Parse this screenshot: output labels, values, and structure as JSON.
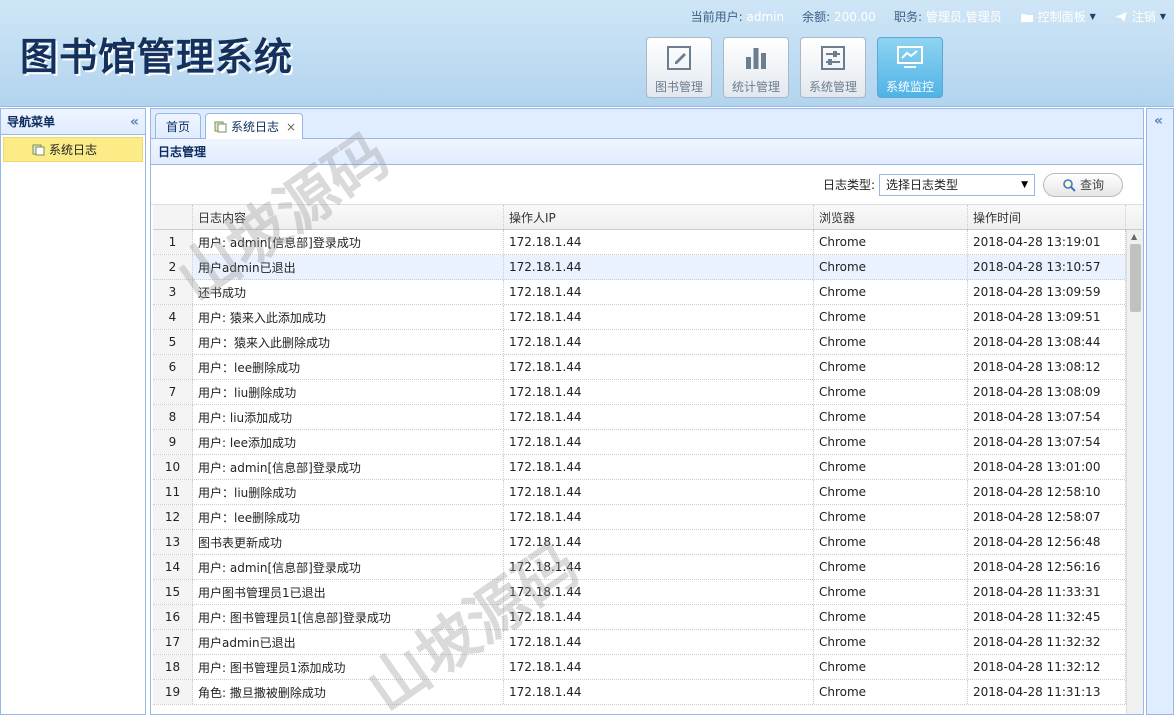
{
  "app": {
    "title": "图书馆管理系统"
  },
  "userbar": {
    "current_user_label": "当前用户:",
    "current_user": "admin",
    "balance_label": "余额:",
    "balance": "200.00",
    "role_label": "职务:",
    "role": "管理员,管理员",
    "control_panel": "控制面板",
    "logout": "注销"
  },
  "modules": [
    {
      "label": "图书管理",
      "icon": "edit-icon"
    },
    {
      "label": "统计管理",
      "icon": "bar-chart-icon"
    },
    {
      "label": "系统管理",
      "icon": "settings-sliders-icon"
    },
    {
      "label": "系统监控",
      "icon": "monitor-icon"
    }
  ],
  "nav": {
    "title": "导航菜单",
    "items": [
      {
        "label": "系统日志"
      }
    ]
  },
  "tabs": [
    {
      "label": "首页"
    },
    {
      "label": "系统日志",
      "close": "×"
    }
  ],
  "panel": {
    "title": "日志管理",
    "filter_label": "日志类型:",
    "filter_value": "选择日志类型",
    "query_button": "查询"
  },
  "grid": {
    "columns": [
      "日志内容",
      "操作人IP",
      "浏览器",
      "操作时间"
    ],
    "rows": [
      {
        "n": "1",
        "content": "用户: admin[信息部]登录成功",
        "ip": "172.18.1.44",
        "browser": "Chrome",
        "time": "2018-04-28 13:19:01"
      },
      {
        "n": "2",
        "content": "用户admin已退出",
        "ip": "172.18.1.44",
        "browser": "Chrome",
        "time": "2018-04-28 13:10:57"
      },
      {
        "n": "3",
        "content": "还书成功",
        "ip": "172.18.1.44",
        "browser": "Chrome",
        "time": "2018-04-28 13:09:59"
      },
      {
        "n": "4",
        "content": "用户: 猿来入此添加成功",
        "ip": "172.18.1.44",
        "browser": "Chrome",
        "time": "2018-04-28 13:09:51"
      },
      {
        "n": "5",
        "content": "用户：猿来入此删除成功",
        "ip": "172.18.1.44",
        "browser": "Chrome",
        "time": "2018-04-28 13:08:44"
      },
      {
        "n": "6",
        "content": "用户：lee删除成功",
        "ip": "172.18.1.44",
        "browser": "Chrome",
        "time": "2018-04-28 13:08:12"
      },
      {
        "n": "7",
        "content": "用户：liu删除成功",
        "ip": "172.18.1.44",
        "browser": "Chrome",
        "time": "2018-04-28 13:08:09"
      },
      {
        "n": "8",
        "content": "用户: liu添加成功",
        "ip": "172.18.1.44",
        "browser": "Chrome",
        "time": "2018-04-28 13:07:54"
      },
      {
        "n": "9",
        "content": "用户: lee添加成功",
        "ip": "172.18.1.44",
        "browser": "Chrome",
        "time": "2018-04-28 13:07:54"
      },
      {
        "n": "10",
        "content": "用户: admin[信息部]登录成功",
        "ip": "172.18.1.44",
        "browser": "Chrome",
        "time": "2018-04-28 13:01:00"
      },
      {
        "n": "11",
        "content": "用户：liu删除成功",
        "ip": "172.18.1.44",
        "browser": "Chrome",
        "time": "2018-04-28 12:58:10"
      },
      {
        "n": "12",
        "content": "用户：lee删除成功",
        "ip": "172.18.1.44",
        "browser": "Chrome",
        "time": "2018-04-28 12:58:07"
      },
      {
        "n": "13",
        "content": "图书表更新成功",
        "ip": "172.18.1.44",
        "browser": "Chrome",
        "time": "2018-04-28 12:56:48"
      },
      {
        "n": "14",
        "content": "用户: admin[信息部]登录成功",
        "ip": "172.18.1.44",
        "browser": "Chrome",
        "time": "2018-04-28 12:56:16"
      },
      {
        "n": "15",
        "content": "用户图书管理员1已退出",
        "ip": "172.18.1.44",
        "browser": "Chrome",
        "time": "2018-04-28 11:33:31"
      },
      {
        "n": "16",
        "content": "用户: 图书管理员1[信息部]登录成功",
        "ip": "172.18.1.44",
        "browser": "Chrome",
        "time": "2018-04-28 11:32:45"
      },
      {
        "n": "17",
        "content": "用户admin已退出",
        "ip": "172.18.1.44",
        "browser": "Chrome",
        "time": "2018-04-28 11:32:32"
      },
      {
        "n": "18",
        "content": "用户: 图书管理员1添加成功",
        "ip": "172.18.1.44",
        "browser": "Chrome",
        "time": "2018-04-28 11:32:12"
      },
      {
        "n": "19",
        "content": "角色: 撒旦撒被删除成功",
        "ip": "172.18.1.44",
        "browser": "Chrome",
        "time": "2018-04-28 11:31:13"
      }
    ]
  },
  "watermark": "山坡源码",
  "colors": {
    "accent": "#95b8e7",
    "active_module": "#4fb3e6",
    "nav_selected": "#fbec88"
  }
}
